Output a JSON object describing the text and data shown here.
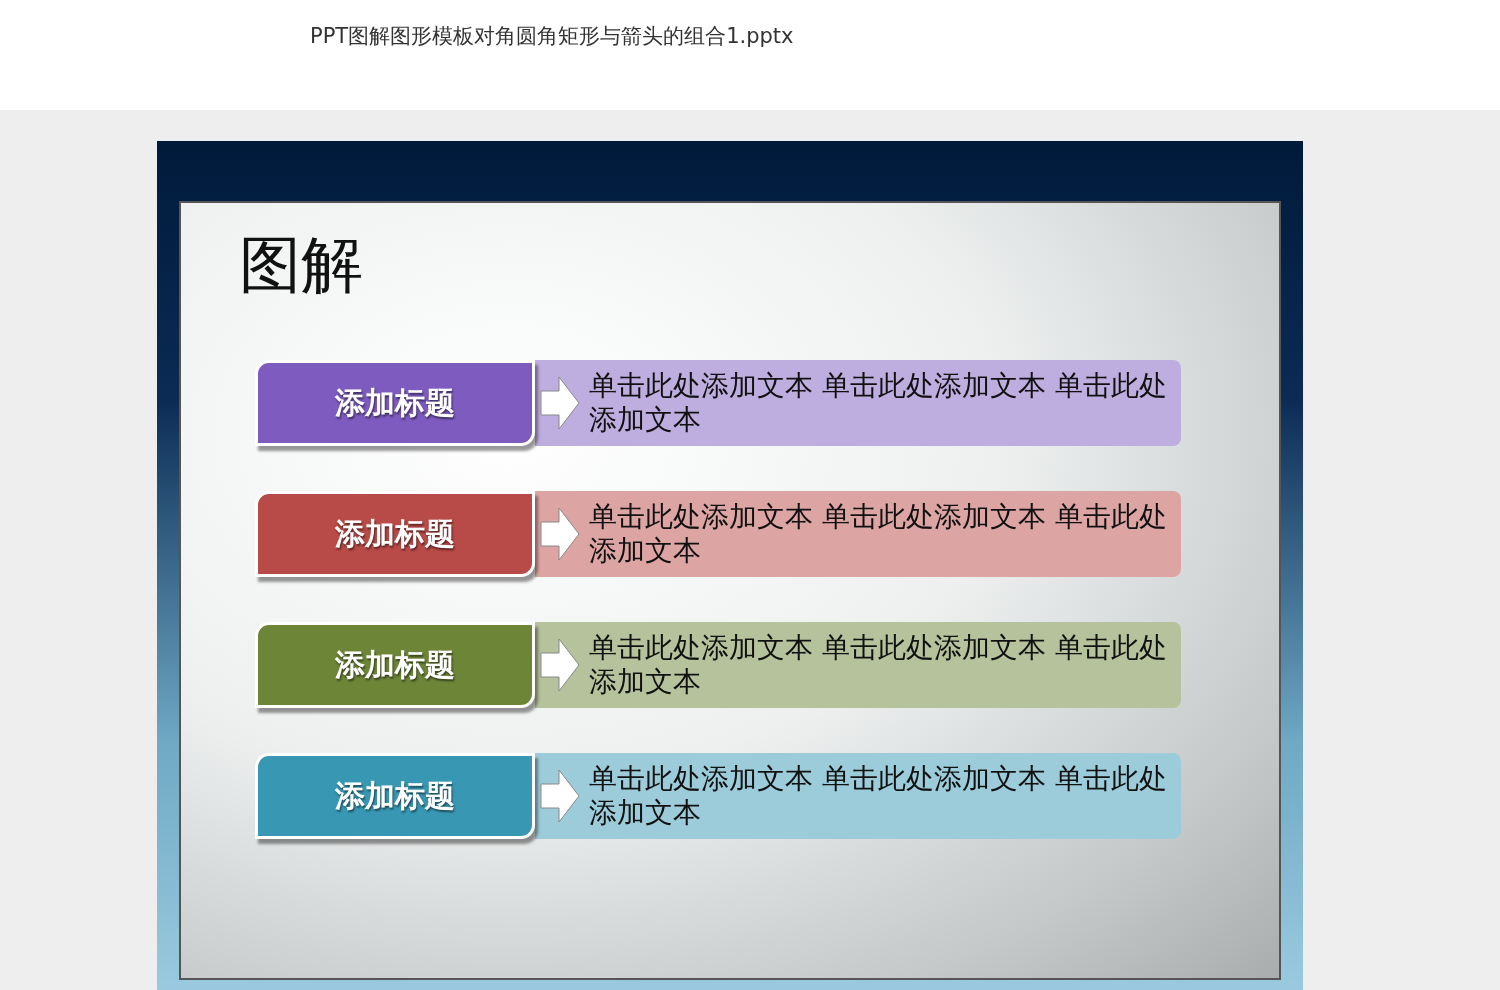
{
  "document": {
    "title": "PPT图解图形模板对角圆角矩形与箭头的组合1.pptx"
  },
  "slide": {
    "title": "图解",
    "rows": [
      {
        "label": "添加标题",
        "text": "单击此处添加文本 单击此处添加文本 单击此处添加文本",
        "color": "#7d5bbf"
      },
      {
        "label": "添加标题",
        "text": "单击此处添加文本 单击此处添加文本 单击此处添加文本",
        "color": "#b84a47"
      },
      {
        "label": "添加标题",
        "text": "单击此处添加文本 单击此处添加文本 单击此处添加文本",
        "color": "#6c8537"
      },
      {
        "label": "添加标题",
        "text": "单击此处添加文本 单击此处添加文本 单击此处添加文本",
        "color": "#3898b4"
      }
    ]
  }
}
